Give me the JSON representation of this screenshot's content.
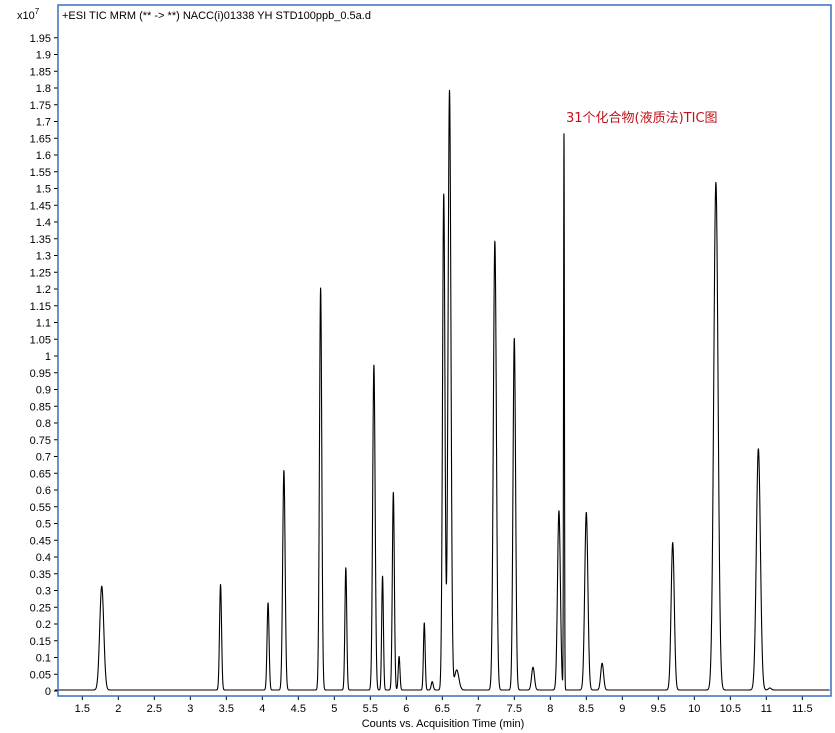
{
  "chart_data": {
    "type": "line",
    "title": "+ESI TIC MRM (** -> **) NACC(i)01338 YH STD100ppb_0.5a.d",
    "xlabel": "Counts vs. Acquisition Time (min)",
    "ylabel": "",
    "y_scale_prefix": "x10",
    "y_scale_exponent": "7",
    "annotation": "31个化合物(液质法)TIC图",
    "xlim": [
      1.1,
      11.9
    ],
    "ylim": [
      -0.02,
      2.0
    ],
    "x_ticks": [
      "1.5",
      "2",
      "2.5",
      "3",
      "3.5",
      "4",
      "4.5",
      "5",
      "5.5",
      "6",
      "6.5",
      "7",
      "7.5",
      "8",
      "8.5",
      "9",
      "9.5",
      "10",
      "10.5",
      "11",
      "11.5"
    ],
    "y_ticks": [
      "0",
      "0.05",
      "0.1",
      "0.15",
      "0.2",
      "0.25",
      "0.3",
      "0.35",
      "0.4",
      "0.45",
      "0.5",
      "0.55",
      "0.6",
      "0.65",
      "0.7",
      "0.75",
      "0.8",
      "0.85",
      "0.9",
      "0.95",
      "1",
      "1.05",
      "1.1",
      "1.15",
      "1.2",
      "1.25",
      "1.3",
      "1.35",
      "1.4",
      "1.45",
      "1.5",
      "1.55",
      "1.6",
      "1.65",
      "1.7",
      "1.75",
      "1.8",
      "1.85",
      "1.9",
      "1.95"
    ],
    "baseline": 0.003,
    "peaks": [
      {
        "rt": 1.77,
        "height": 0.31,
        "width": 0.028
      },
      {
        "rt": 3.42,
        "height": 0.315,
        "width": 0.014
      },
      {
        "rt": 4.08,
        "height": 0.26,
        "width": 0.014
      },
      {
        "rt": 4.3,
        "height": 0.655,
        "width": 0.017
      },
      {
        "rt": 4.81,
        "height": 1.2,
        "width": 0.016
      },
      {
        "rt": 5.16,
        "height": 0.365,
        "width": 0.013
      },
      {
        "rt": 5.55,
        "height": 0.97,
        "width": 0.017
      },
      {
        "rt": 5.67,
        "height": 0.34,
        "width": 0.012
      },
      {
        "rt": 5.82,
        "height": 0.59,
        "width": 0.014
      },
      {
        "rt": 5.9,
        "height": 0.1,
        "width": 0.012
      },
      {
        "rt": 6.25,
        "height": 0.2,
        "width": 0.012
      },
      {
        "rt": 6.36,
        "height": 0.025,
        "width": 0.014
      },
      {
        "rt": 6.52,
        "height": 1.48,
        "width": 0.017
      },
      {
        "rt": 6.6,
        "height": 1.79,
        "width": 0.02
      },
      {
        "rt": 6.7,
        "height": 0.06,
        "width": 0.03
      },
      {
        "rt": 7.23,
        "height": 1.34,
        "width": 0.021
      },
      {
        "rt": 7.5,
        "height": 1.05,
        "width": 0.018
      },
      {
        "rt": 7.76,
        "height": 0.068,
        "width": 0.02
      },
      {
        "rt": 8.12,
        "height": 0.535,
        "width": 0.02
      },
      {
        "rt": 8.19,
        "height": 1.665,
        "width": 0.006
      },
      {
        "rt": 8.5,
        "height": 0.53,
        "width": 0.022
      },
      {
        "rt": 8.72,
        "height": 0.08,
        "width": 0.02
      },
      {
        "rt": 9.7,
        "height": 0.44,
        "width": 0.022
      },
      {
        "rt": 10.3,
        "height": 1.515,
        "width": 0.03
      },
      {
        "rt": 10.89,
        "height": 0.72,
        "width": 0.028
      },
      {
        "rt": 11.05,
        "height": 0.006,
        "width": 0.02
      }
    ],
    "line_color": "#000000",
    "annotation_color": "#c0101a",
    "frame_color": "#3c6fbd",
    "grid": false
  }
}
